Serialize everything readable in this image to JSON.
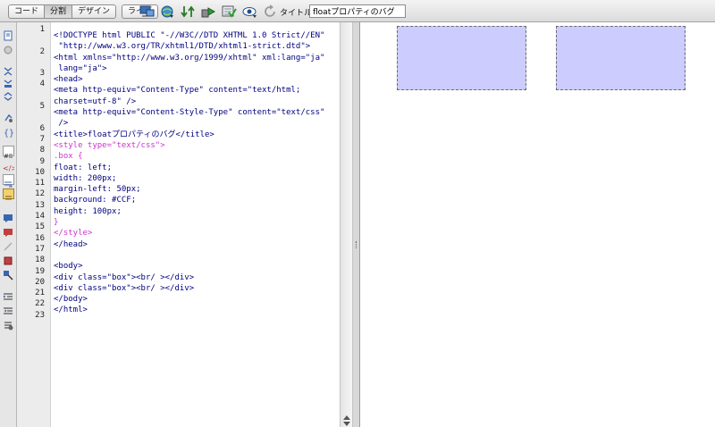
{
  "toolbar": {
    "views": [
      "コード",
      "分割",
      "デザイン"
    ],
    "live_view": "ライブ",
    "icons": [
      "multiscreen-icon",
      "browser-preview-icon",
      "file-management-icon",
      "debug-icon",
      "validate-icon",
      "visual-aids-icon",
      "refresh-icon"
    ],
    "title_label": "タイトル：",
    "title_value": "floatプロパティのバグ"
  },
  "left_tools": [
    "open-documents-icon",
    "show-code-navigator-icon",
    "collapse-full-tag-icon",
    "collapse-selection-icon",
    "expand-all-icon",
    "select-parent-tag-icon",
    "balance-braces-icon",
    "line-numbers-icon",
    "highlight-invalid-code-icon",
    "word-wrap-icon",
    "syntax-coloring-icon",
    "apply-comment-icon",
    "remove-comment-icon",
    "wrap-tag-icon",
    "recent-snippets-icon",
    "move-css-icon",
    "indent-code-icon",
    "outdent-code-icon",
    "format-source-code-icon"
  ],
  "code_lines": [
    {
      "n": "1",
      "text": "<!DOCTYPE html PUBLIC \"-//W3C//DTD XHTML 1.0 Strict//EN\"",
      "style": "blue"
    },
    {
      "n": "",
      "text": " \"http://www.w3.org/TR/xhtml1/DTD/xhtml1-strict.dtd\">",
      "style": "blue"
    },
    {
      "n": "2",
      "text": "<html xmlns=\"http://www.w3.org/1999/xhtml\" xml:lang=\"ja\"",
      "style": "blue"
    },
    {
      "n": "",
      "text": " lang=\"ja\">",
      "style": "blue"
    },
    {
      "n": "3",
      "text": "<head>",
      "style": "blue"
    },
    {
      "n": "4",
      "text": "<meta http-equiv=\"Content-Type\" content=\"text/html;",
      "style": "blue"
    },
    {
      "n": "",
      "text": "charset=utf-8\" />",
      "style": "blue"
    },
    {
      "n": "5",
      "text": "<meta http-equiv=\"Content-Style-Type\" content=\"text/css\"",
      "style": "blue"
    },
    {
      "n": "",
      "text": " />",
      "style": "blue"
    },
    {
      "n": "6",
      "text": "<title>floatプロパティのバグ</title>",
      "style": "blue"
    },
    {
      "n": "7",
      "text": "<style type=\"text/css\">",
      "style": "magenta"
    },
    {
      "n": "8",
      "text": ".box {",
      "style": "magenta"
    },
    {
      "n": "9",
      "text": "float: left;",
      "style": "blue"
    },
    {
      "n": "10",
      "text": "width: 200px;",
      "style": "blue"
    },
    {
      "n": "11",
      "text": "margin-left: 50px;",
      "style": "blue"
    },
    {
      "n": "12",
      "text": "background: #CCF;",
      "style": "blue"
    },
    {
      "n": "13",
      "text": "height: 100px;",
      "style": "blue"
    },
    {
      "n": "14",
      "text": "}",
      "style": "magenta"
    },
    {
      "n": "15",
      "text": "</style>",
      "style": "magenta"
    },
    {
      "n": "16",
      "text": "</head>",
      "style": "blue"
    },
    {
      "n": "17",
      "text": "",
      "style": "blue"
    },
    {
      "n": "18",
      "text": "<body>",
      "style": "blue"
    },
    {
      "n": "19",
      "text": "<div class=\"box\"><br/ ></div>",
      "style": "blue"
    },
    {
      "n": "20",
      "text": "<div class=\"box\"><br/ ></div>",
      "style": "blue"
    },
    {
      "n": "21",
      "text": "</body>",
      "style": "blue"
    },
    {
      "n": "22",
      "text": "</html>",
      "style": "blue"
    },
    {
      "n": "23",
      "text": "",
      "style": "blue"
    }
  ],
  "design_view": {
    "box_color": "#CCCCFF",
    "box_count": 2
  },
  "colors": {
    "tag_blue": "#000080",
    "css_magenta": "#CC33CC",
    "box_fill": "#CCCCFF"
  }
}
